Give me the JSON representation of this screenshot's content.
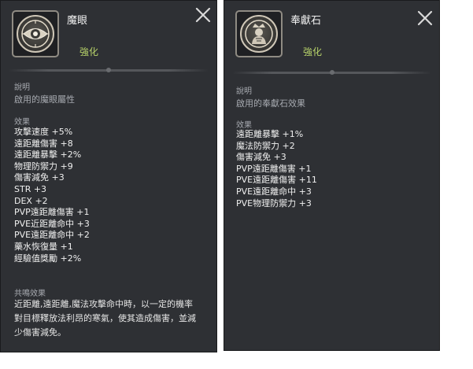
{
  "left_card": {
    "title": "魔眼",
    "subtitle": "強化",
    "icon": "eye-emblem-icon",
    "desc_label": "說明",
    "desc": "啟用的魔眼屬性",
    "effects_label": "效果",
    "effects": [
      "攻擊速度 +5%",
      "遠距離傷害 +8",
      "遠距離暴擊 +2%",
      "物理防禦力 +9",
      "傷害減免 +3",
      "STR +3",
      "DEX +2",
      "PVP遠距離傷害 +1",
      "PVE近距離命中 +3",
      "PVE遠距離命中 +2",
      "藥水恢復量 +1",
      "經驗值獎勵 +2%"
    ],
    "resonance_label": "共鳴效果",
    "resonance_lines": [
      "近距離,遠距離,魔法攻擊命中時，以一定的機率",
      "對目標釋放法利昂的寒氣，使其造成傷害，並減",
      "少傷害減免。"
    ]
  },
  "right_card": {
    "title": "奉獻石",
    "subtitle": "強化",
    "icon": "offering-stone-icon",
    "desc_label": "說明",
    "desc": "啟用的奉獻石效果",
    "effects_label": "效果",
    "effects": [
      "遠距離暴擊 +1%",
      "魔法防禦力 +2",
      "傷害減免 +3",
      "PVP遠距離傷害 +1",
      "PVE遠距離傷害 +11",
      "PVE遠距離命中 +3",
      "PVE物理防禦力 +3"
    ]
  },
  "colors": {
    "panel_bg": "#2e3034",
    "subtitle": "#b8d36a",
    "label": "#a7aab0",
    "text": "#f0f0f0"
  }
}
